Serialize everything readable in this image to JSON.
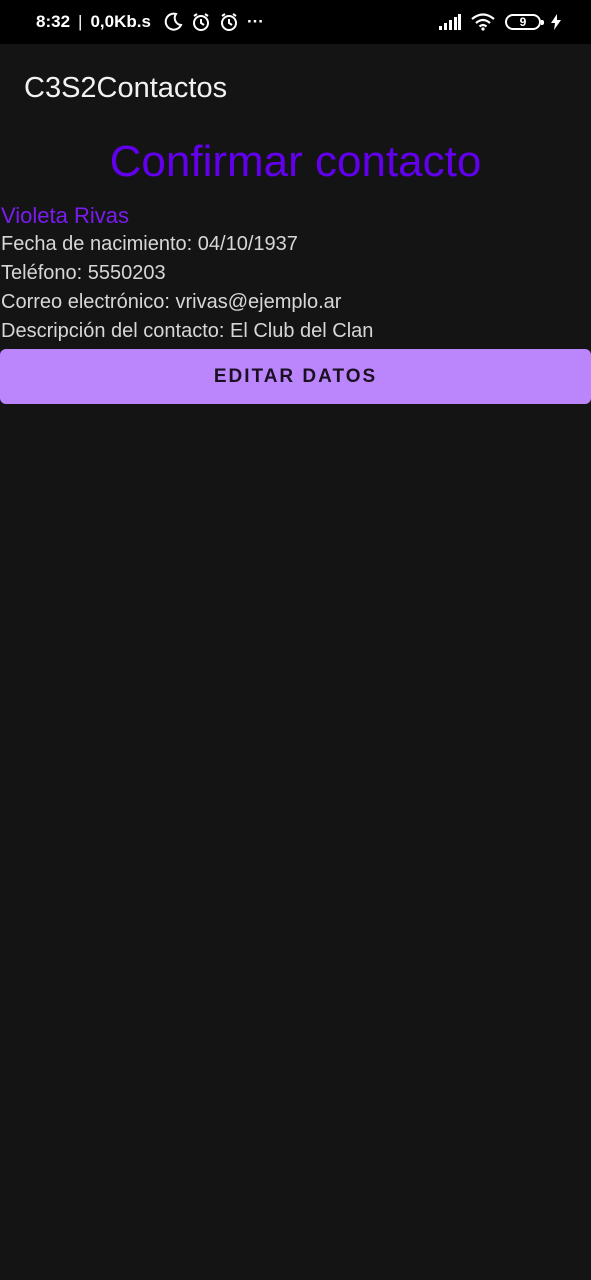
{
  "status_bar": {
    "time": "8:32",
    "separator": "|",
    "net_speed": "0,0Kb.s",
    "more": "···",
    "battery": "9",
    "icons": [
      "moon-icon",
      "alarm-icon",
      "alarm-icon",
      "signal-icon",
      "wifi-icon",
      "battery-icon",
      "charging-icon"
    ]
  },
  "app_bar": {
    "title": "C3S2Contactos"
  },
  "screen": {
    "heading": "Confirmar contacto",
    "name": "Violeta Rivas",
    "birth": "Fecha de nacimiento: 04/10/1937",
    "phone": "Teléfono: 5550203",
    "email": "Correo electrónico: vrivas@ejemplo.ar",
    "description": "Descripción del contacto: El Club del Clan",
    "edit_button": "EDITAR DATOS"
  },
  "colors": {
    "background": "#141414",
    "accent": "#6200ee",
    "button": "#bb86fc"
  }
}
